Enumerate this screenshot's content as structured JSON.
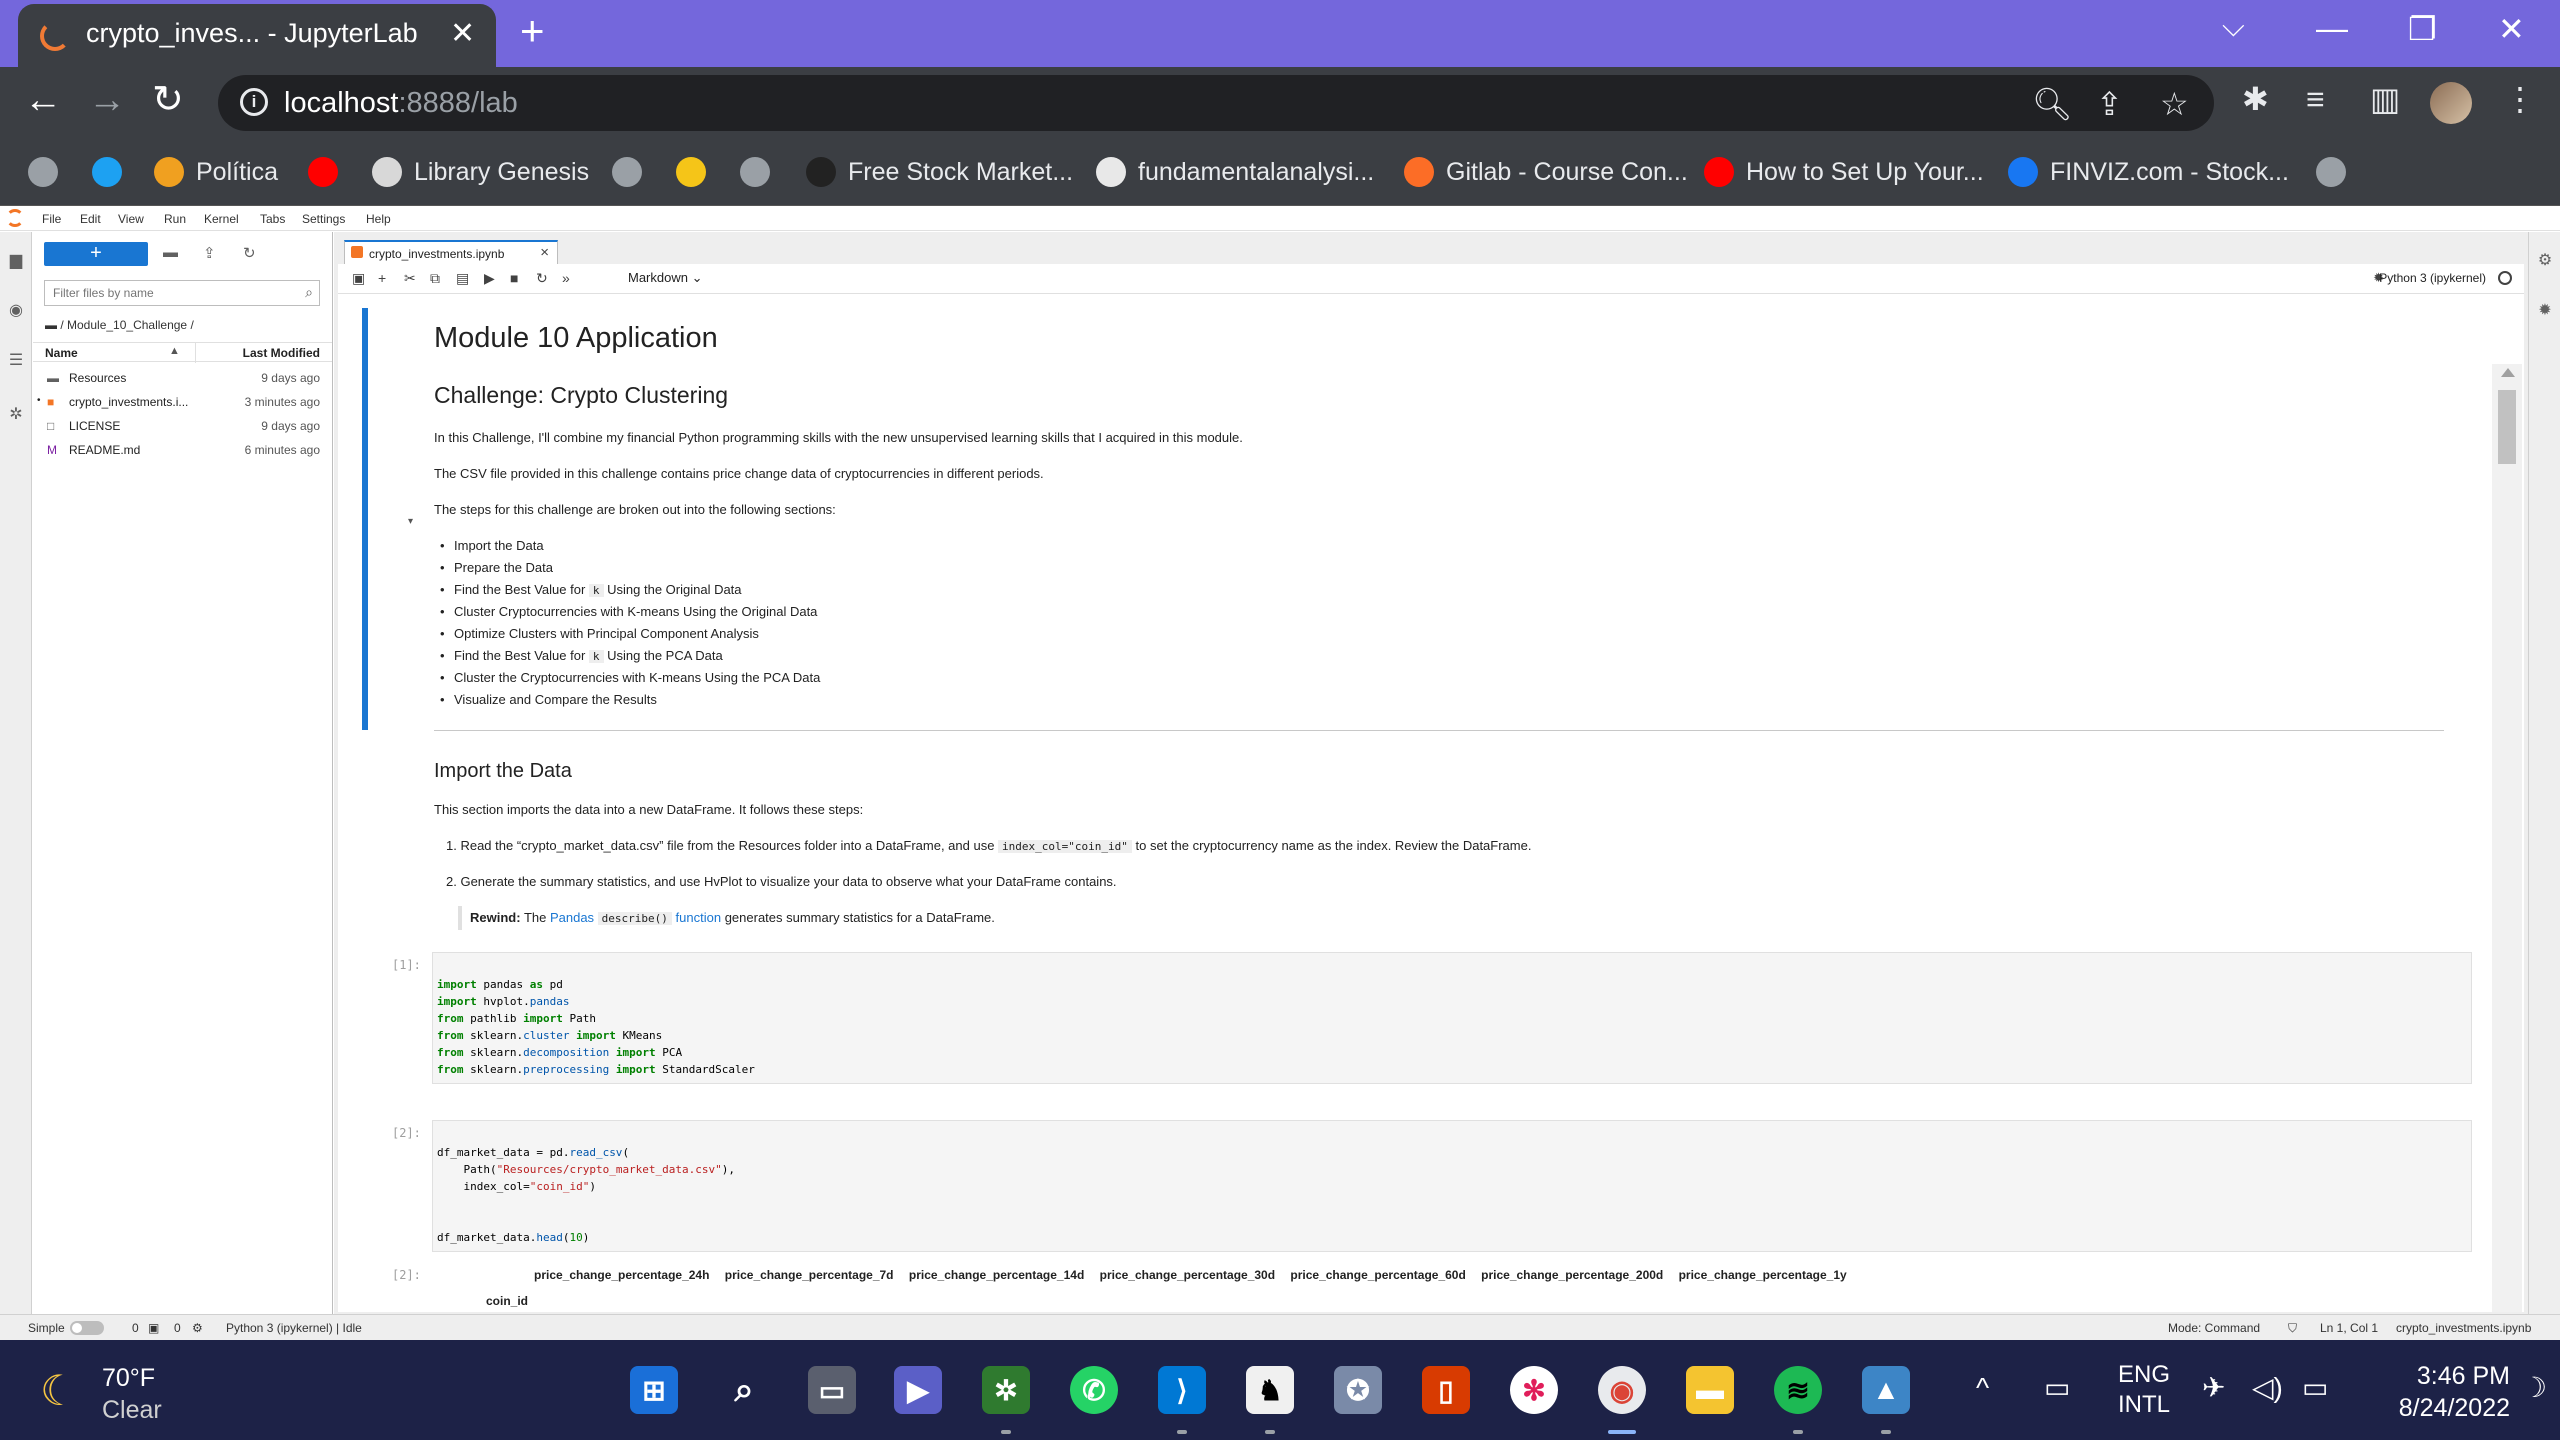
{
  "browser": {
    "tab_title": "crypto_inves... - JupyterLab",
    "url_host": "localhost",
    "url_rest": ":8888/lab",
    "bookmarks": [
      {
        "label": "",
        "color": "#9aa0a6"
      },
      {
        "label": "",
        "color": "#1da1f2"
      },
      {
        "label": "Política",
        "color": "#f0a020"
      },
      {
        "label": "",
        "color": "#ff0000"
      },
      {
        "label": "Library Genesis",
        "color": "#d8d8d8"
      },
      {
        "label": "",
        "color": "#9aa0a6"
      },
      {
        "label": "",
        "color": "#f5c518"
      },
      {
        "label": "",
        "color": "#9aa0a6"
      },
      {
        "label": "Free Stock Market...",
        "color": "#222222"
      },
      {
        "label": "fundamentalanalysi...",
        "color": "#e8e8e8"
      },
      {
        "label": "Gitlab - Course Con...",
        "color": "#fc6d26"
      },
      {
        "label": "How to Set Up Your...",
        "color": "#ff0000"
      },
      {
        "label": "FINVIZ.com - Stock...",
        "color": "#1877f2"
      },
      {
        "label": "",
        "color": "#9aa0a6"
      }
    ]
  },
  "menu": [
    "File",
    "Edit",
    "View",
    "Run",
    "Kernel",
    "Tabs",
    "Settings",
    "Help"
  ],
  "filebrowser": {
    "filter_placeholder": "Filter files by name",
    "breadcrumb": "/ Module_10_Challenge /",
    "col_name": "Name",
    "col_modified": "Last Modified",
    "files": [
      {
        "name": "Resources",
        "modified": "9 days ago",
        "icon": "folder-icon"
      },
      {
        "name": "crypto_investments.i...",
        "modified": "3 minutes ago",
        "icon": "notebook-icon"
      },
      {
        "name": "LICENSE",
        "modified": "9 days ago",
        "icon": "file-icon"
      },
      {
        "name": "README.md",
        "modified": "6 minutes ago",
        "icon": "markdown-icon"
      }
    ]
  },
  "notebook": {
    "tab_label": "crypto_investments.ipynb",
    "cell_type": "Markdown",
    "kernel": "Python 3 (ipykernel)",
    "title": "Module 10 Application",
    "subtitle": "Challenge: Crypto Clustering",
    "intro1": "In this Challenge, I'll combine my financial Python programming skills with the new unsupervised learning skills that I acquired in this module.",
    "intro2": "The CSV file provided in this challenge contains price change data of cryptocurrencies in different periods.",
    "intro3": "The steps for this challenge are broken out into the following sections:",
    "steps": [
      "Import the Data",
      "Prepare the Data",
      "Find the Best Value for ",
      "Cluster Cryptocurrencies with K-means Using the Original Data",
      "Optimize Clusters with Principal Component Analysis",
      "Find the Best Value for ",
      "Cluster the Cryptocurrencies with K-means Using the PCA Data",
      "Visualize and Compare the Results"
    ],
    "k_code": "k",
    "step3_suffix": " Using the Original Data",
    "step6_suffix": " Using the PCA Data",
    "import_heading": "Import the Data",
    "import_intro": "This section imports the data into a new DataFrame. It follows these steps:",
    "ol1_pre": "1. Read the “crypto_market_data.csv” file from the Resources folder into a DataFrame, and use ",
    "ol1_code": "index_col=\"coin_id\"",
    "ol1_post": " to set the cryptocurrency name as the index. Review the DataFrame.",
    "ol2": "2. Generate the summary statistics, and use HvPlot to visualize your data to observe what your DataFrame contains.",
    "rewind_label": "Rewind:",
    "rewind_pre": " The ",
    "rewind_link1": "Pandas",
    "rewind_code": "describe()",
    "rewind_link2": "function",
    "rewind_post": " generates summary statistics for a DataFrame.",
    "prompt1": "[1]:",
    "prompt2": "[2]:",
    "prompt3": "[2]:",
    "out_cols": [
      "price_change_percentage_24h",
      "price_change_percentage_7d",
      "price_change_percentage_14d",
      "price_change_percentage_30d",
      "price_change_percentage_60d",
      "price_change_percentage_200d",
      "price_change_percentage_1y"
    ],
    "out_index": "coin_id"
  },
  "statusbar": {
    "mode": "Simple",
    "count1": "0",
    "count2": "0",
    "kernel_status": "Python 3 (ipykernel) | Idle",
    "command_mode": "Mode: Command",
    "cursor": "Ln 1, Col 1",
    "filename": "crypto_investments.ipynb"
  },
  "taskbar": {
    "temp": "70°F",
    "condition": "Clear",
    "lang1": "ENG",
    "lang2": "INTL",
    "time": "3:46 PM",
    "date": "8/24/2022"
  }
}
